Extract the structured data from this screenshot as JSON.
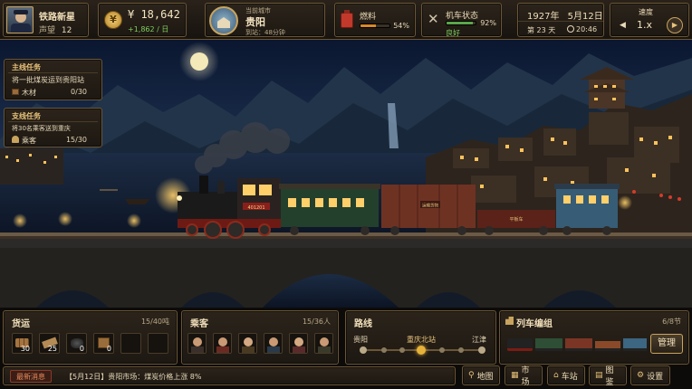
{
  "player": {
    "name": "铁路新星",
    "fame_label": "声望",
    "fame_value": "12"
  },
  "money": {
    "amount": "¥ 18,642",
    "rate": "+1,862 / 日"
  },
  "city": {
    "label": "当前城市",
    "name": "贵阳",
    "arrival": "到站：48分钟"
  },
  "fuel": {
    "label": "燃料",
    "percent_text": "54%",
    "level": 0.54
  },
  "condition": {
    "label": "机车状态",
    "status": "良好",
    "percent_text": "92%",
    "level": 0.92
  },
  "date": {
    "year": "1927年",
    "day_month": "5月12日",
    "day_count": "第 23 天",
    "time": "20:46"
  },
  "speed": {
    "label": "速度",
    "value": "1.x"
  },
  "main_quest": {
    "header": "主线任务",
    "title": "将一批煤炭运到贵阳站",
    "item": "木材",
    "progress": "0/30"
  },
  "side_quest": {
    "header": "支线任务",
    "title": "将30名乘客送到重庆",
    "item": "乘客",
    "progress": "15/30"
  },
  "cargo": {
    "title": "货运",
    "count": "15/40吨",
    "slots": [
      {
        "icon": "lumber-icon",
        "qty": "30"
      },
      {
        "icon": "plank-icon",
        "qty": "25"
      },
      {
        "icon": "coal-icon",
        "qty": "0"
      },
      {
        "icon": "crate-icon",
        "qty": "0"
      },
      {
        "icon": "empty-slot",
        "qty": ""
      },
      {
        "icon": "empty-slot",
        "qty": ""
      }
    ]
  },
  "passengers": {
    "title": "乘客",
    "count": "15/36人"
  },
  "route": {
    "title": "路线",
    "from": "贵阳",
    "current": "重庆北站",
    "to": "江津"
  },
  "consist": {
    "title": "列车编组",
    "count": "6/8节",
    "manage": "管理"
  },
  "news": {
    "label": "最新消息",
    "text": "【5月12日】贵阳市场：煤炭价格上涨 8%"
  },
  "nav": {
    "map": "地图",
    "market": "市场",
    "station": "车站",
    "atlas": "图鉴",
    "settings": "设置"
  },
  "train_labels": {
    "engine_plate": "401201",
    "freight": "运输货物",
    "flatcar": "平板车"
  },
  "colors": {
    "accent": "#e7c27a",
    "fuel": "#d8892a",
    "condition": "#5aa64a",
    "panel_border": "#6b5636"
  }
}
